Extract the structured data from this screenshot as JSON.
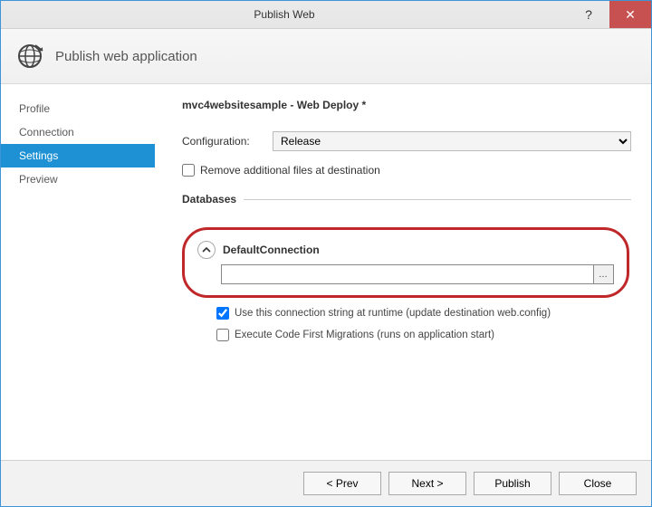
{
  "window": {
    "title": "Publish Web",
    "help_glyph": "?",
    "close_glyph": "✕"
  },
  "header": {
    "title": "Publish web application"
  },
  "sidebar": {
    "items": [
      {
        "label": "Profile"
      },
      {
        "label": "Connection"
      },
      {
        "label": "Settings"
      },
      {
        "label": "Preview"
      }
    ]
  },
  "content": {
    "heading": "mvc4websitesample - Web Deploy *",
    "configuration_label": "Configuration:",
    "configuration_value": "Release",
    "remove_files_label": "Remove additional files at destination",
    "databases_section": "Databases",
    "db_name": "DefaultConnection",
    "connection_value": "",
    "use_conn_label": "Use this connection string at runtime (update destination web.config)",
    "exec_migrations_label": "Execute Code First Migrations (runs on application start)"
  },
  "footer": {
    "prev": "< Prev",
    "next": "Next >",
    "publish": "Publish",
    "close": "Close"
  }
}
